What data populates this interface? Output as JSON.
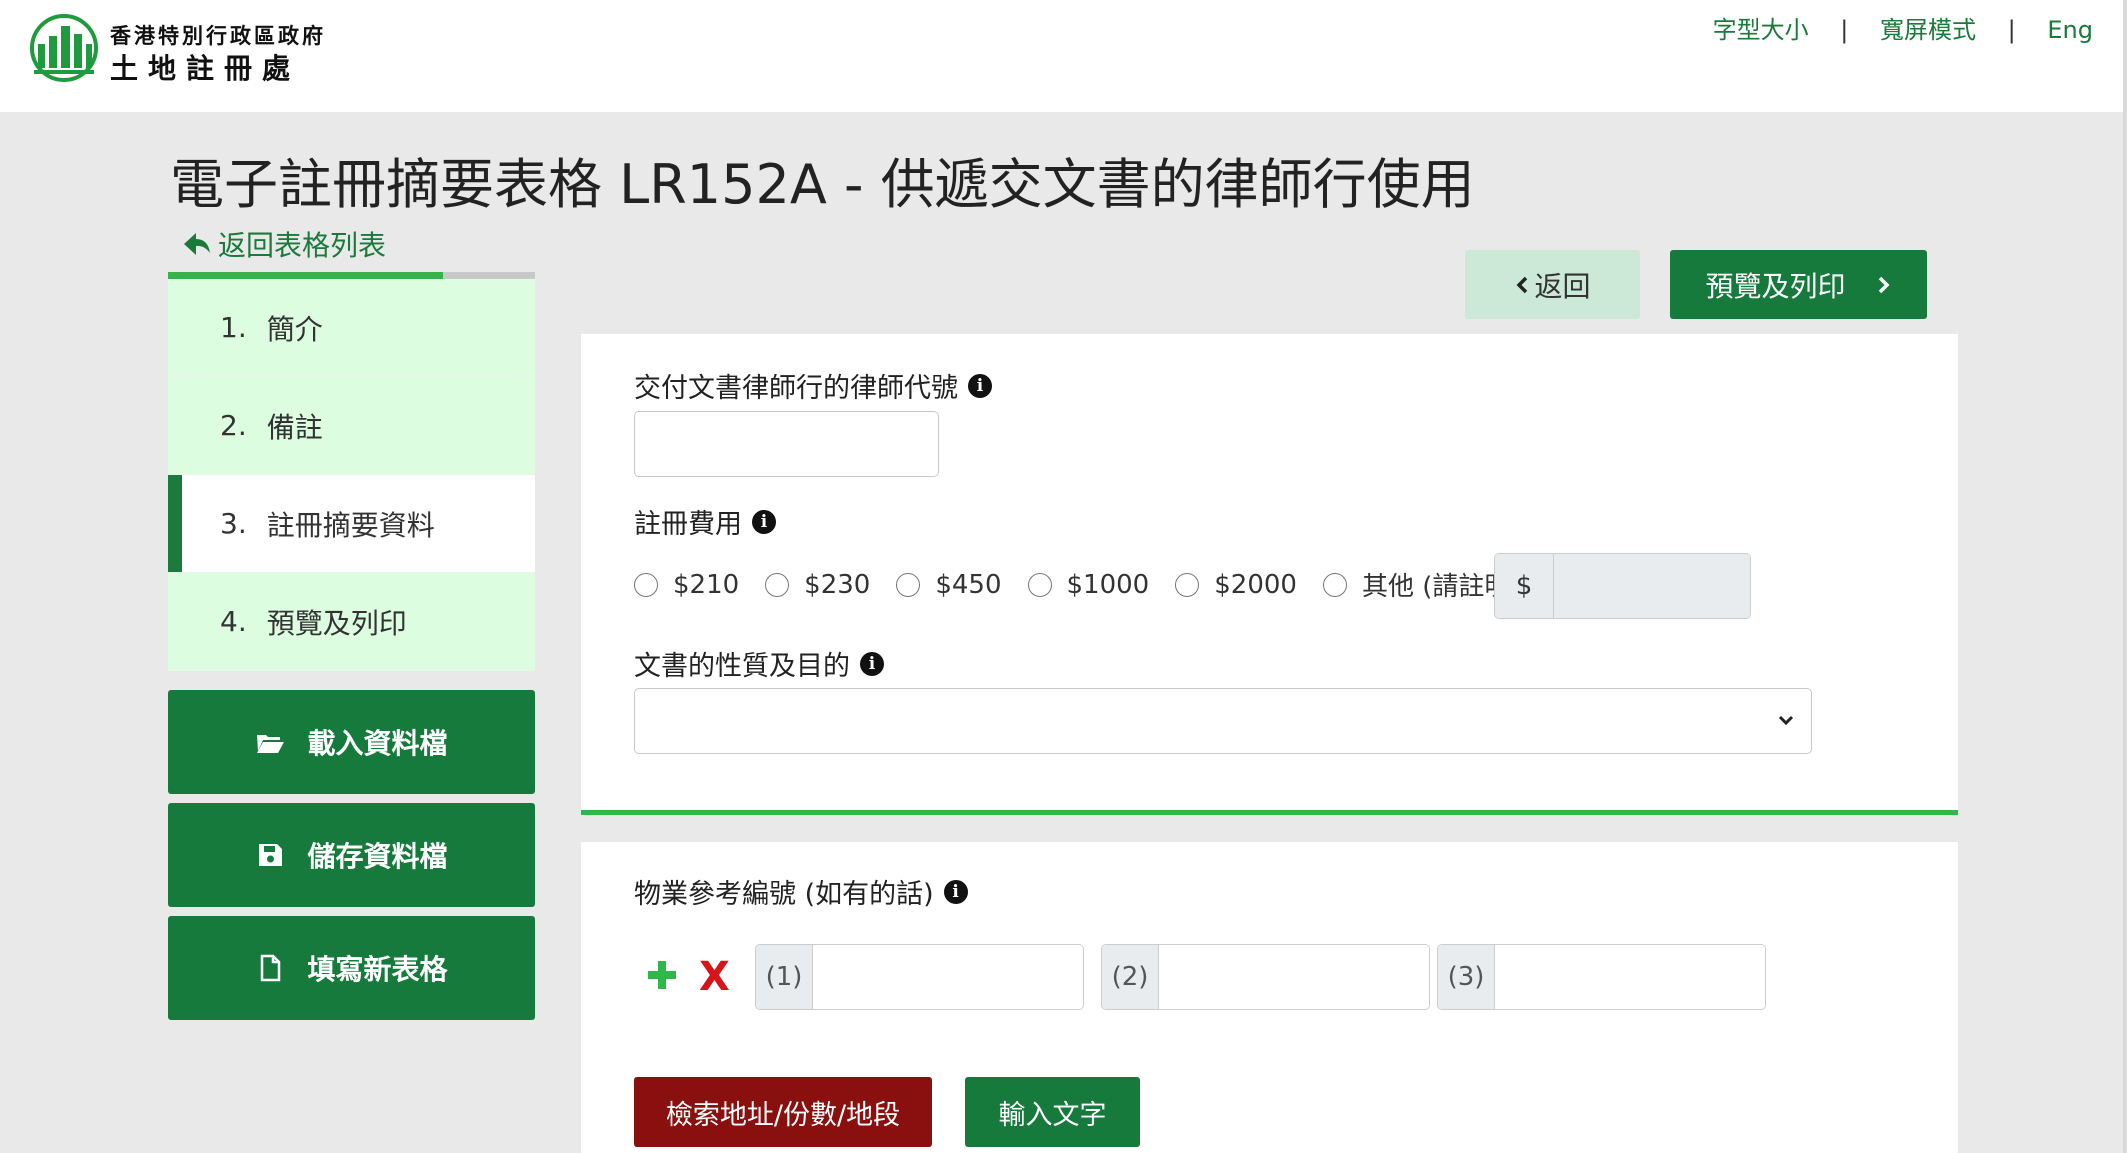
{
  "header": {
    "org_line1": "香港特別行政區政府",
    "org_line2": "土地註冊處",
    "links": [
      "字型大小",
      "寬屏模式",
      "Eng"
    ],
    "separator": "|"
  },
  "page": {
    "title": "電子註冊摘要表格 LR152A - 供遞交文書的律師行使用",
    "back_to_list": "返回表格列表"
  },
  "progress": {
    "fraction": 0.75
  },
  "steps": [
    {
      "num": "1.",
      "label": "簡介",
      "active": false
    },
    {
      "num": "2.",
      "label": "備註",
      "active": false
    },
    {
      "num": "3.",
      "label": "註冊摘要資料",
      "active": true
    },
    {
      "num": "4.",
      "label": "預覽及列印",
      "active": false
    }
  ],
  "side_buttons": {
    "load": "載入資料檔",
    "save": "儲存資料檔",
    "new_form": "填寫新表格"
  },
  "nav": {
    "back": "返回",
    "preview": "預覽及列印"
  },
  "form": {
    "firm_code_label": "交付文書律師行的律師代號",
    "fee_label": "註冊費用",
    "fee_options": [
      "$210",
      "$230",
      "$450",
      "$1000",
      "$2000",
      "其他 (請註明)"
    ],
    "currency_symbol": "$",
    "nature_label": "文書的性質及目的",
    "property_ref_label": "物業參考編號 (如有的話)",
    "ref_prefixes": [
      "(1)",
      "(2)",
      "(3)"
    ],
    "search_button": "檢索地址/份數/地段",
    "enter_text_button": "輸入文字"
  },
  "colors": {
    "brand_green": "#167a3c",
    "light_green": "#ddfde0",
    "accent_green": "#2eb84a",
    "danger_red": "#8a0f0f",
    "remove_red": "#d6141b"
  }
}
